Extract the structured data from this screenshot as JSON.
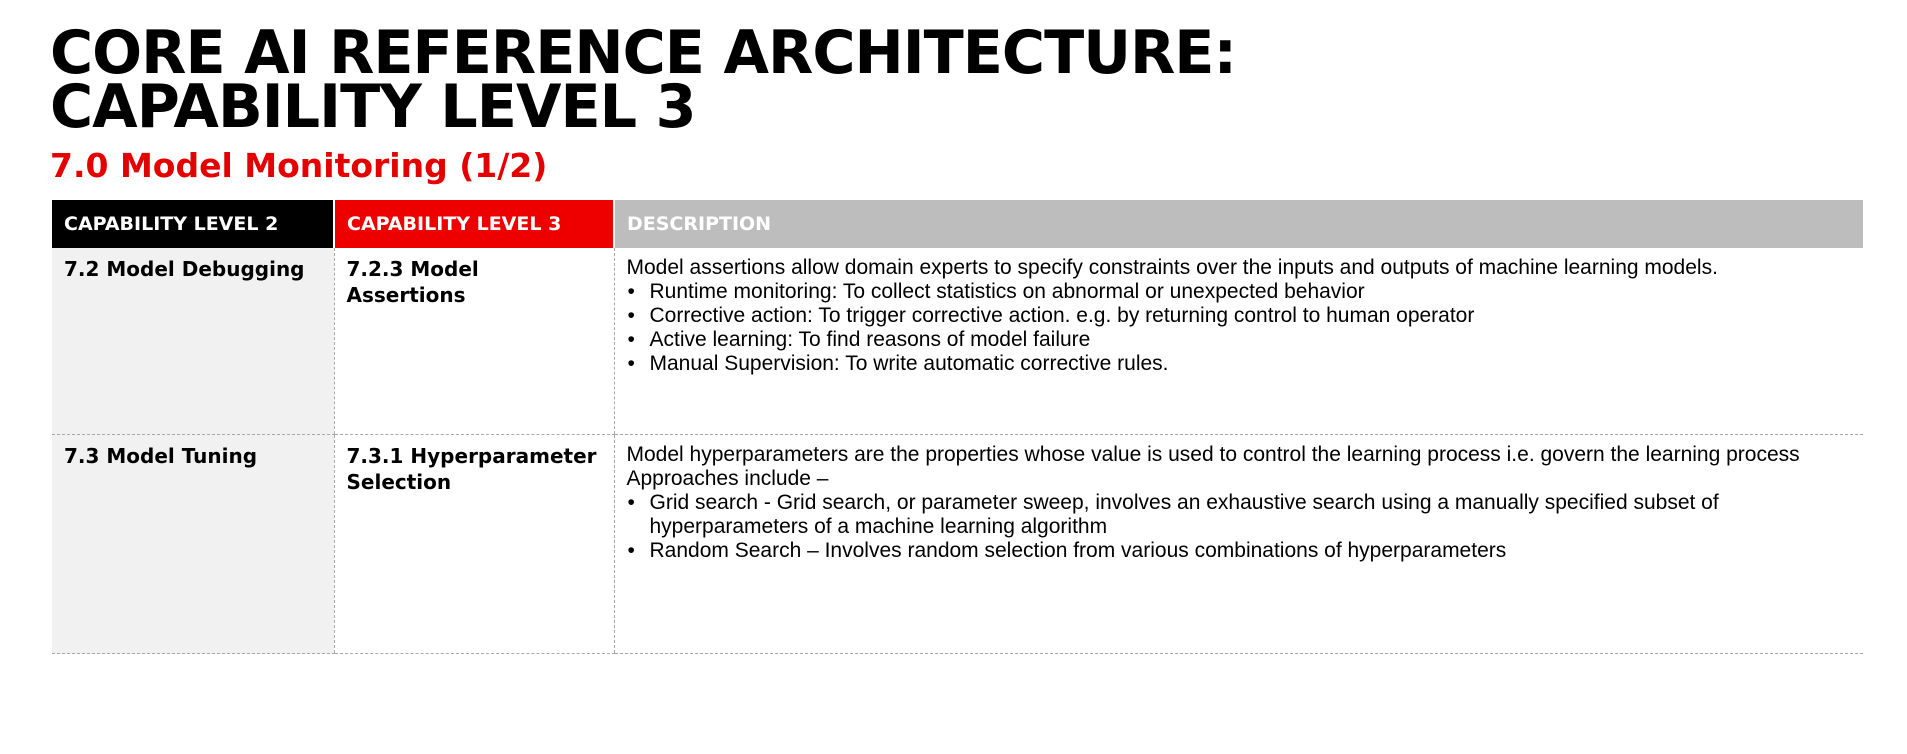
{
  "title": {
    "line1": "CORE AI REFERENCE ARCHITECTURE:",
    "line2": "CAPABILITY LEVEL 3"
  },
  "subtitle": "7.0 Model Monitoring (1/2)",
  "colors": {
    "accent_red": "#ee0000",
    "header_black": "#000000",
    "header_gray": "#bdbdbd",
    "first_col_bg": "#f1f1f1"
  },
  "table": {
    "headers": [
      "CAPABILITY LEVEL 2",
      "CAPABILITY LEVEL 3",
      "DESCRIPTION"
    ],
    "rows": [
      {
        "level2": "7.2 Model Debugging",
        "level3": "7.2.3 Model Assertions",
        "intro": [
          "Model assertions allow domain experts to specify constraints over the inputs and outputs of machine learning models."
        ],
        "bullets": [
          "Runtime monitoring: To collect statistics on abnormal or unexpected behavior",
          "Corrective action: To trigger corrective action. e.g. by returning control to human operator",
          "Active learning: To find reasons of model failure",
          "Manual Supervision: To write automatic corrective rules."
        ]
      },
      {
        "level2": "7.3 Model Tuning",
        "level3": "7.3.1 Hyperparameter Selection",
        "intro": [
          "Model hyperparameters are the properties whose value is used to control the learning process i.e. govern the learning process",
          "Approaches include –"
        ],
        "bullets": [
          "Grid search - Grid search, or parameter sweep, involves an exhaustive search using a manually specified subset of hyperparameters of a machine learning algorithm",
          "Random Search – Involves random selection from various combinations of hyperparameters"
        ]
      }
    ]
  }
}
